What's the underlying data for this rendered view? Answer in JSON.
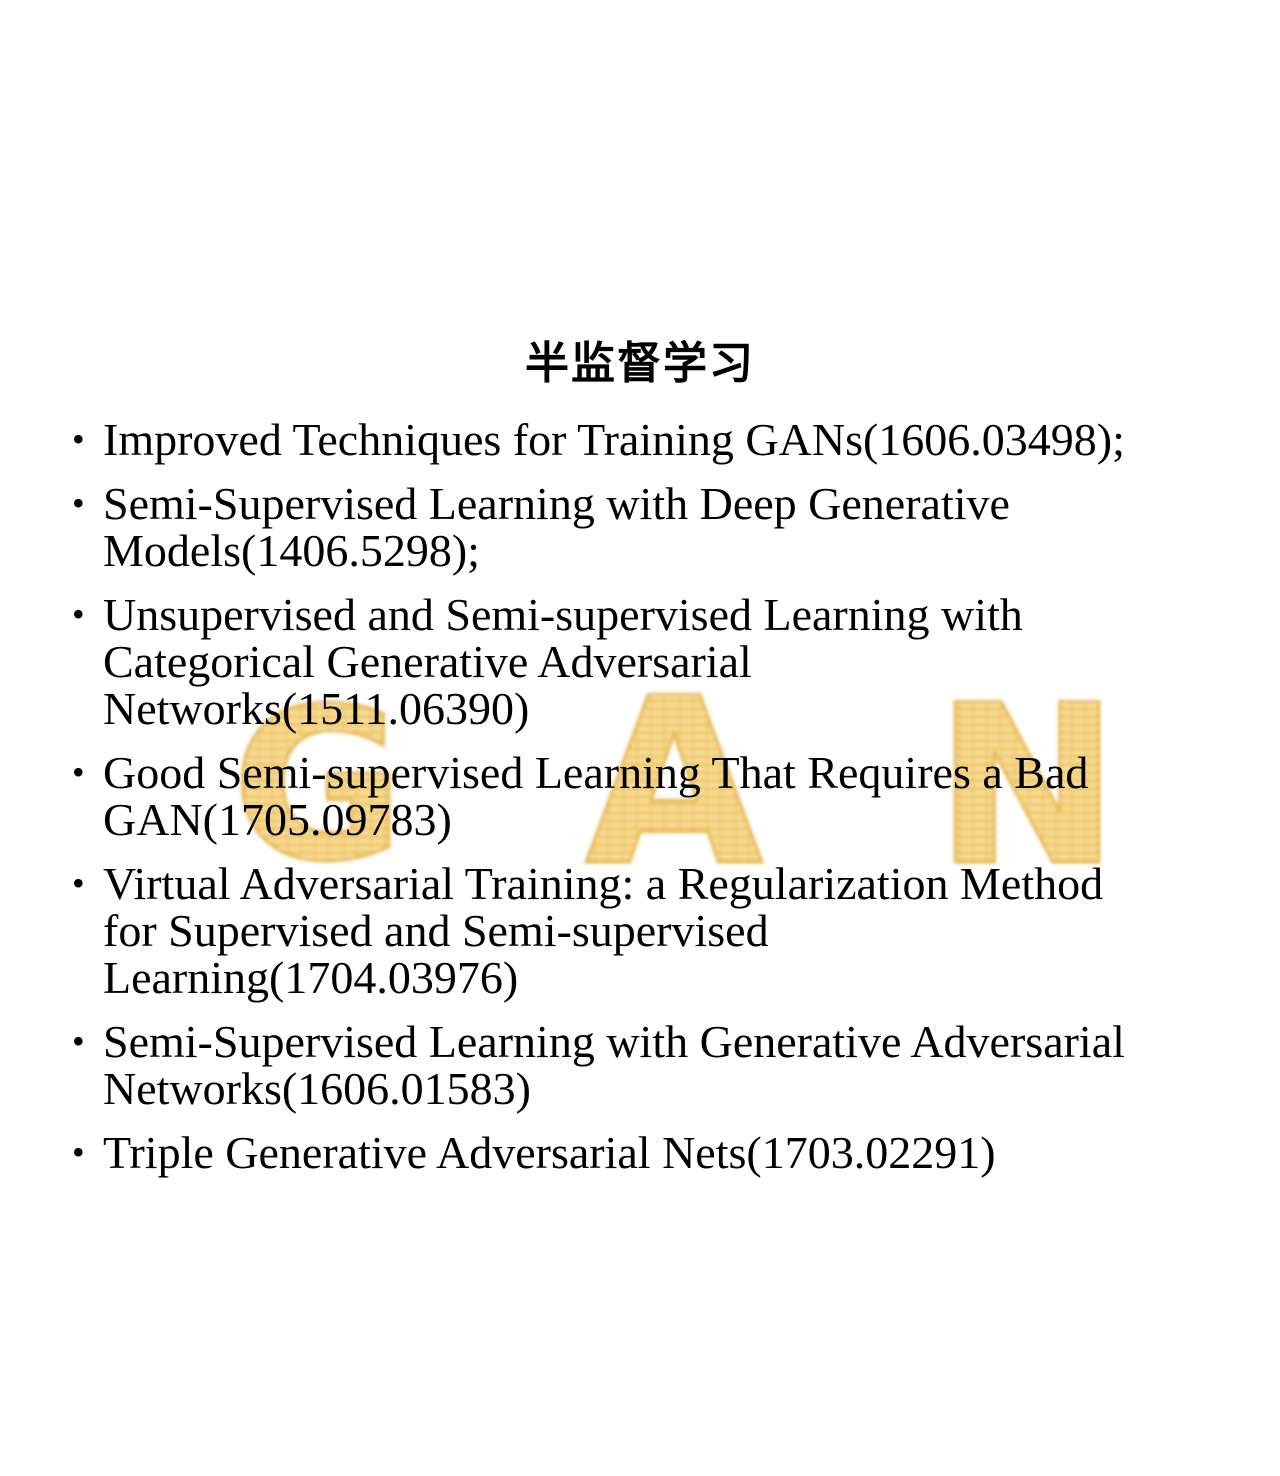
{
  "title": "半监督学习",
  "watermark": {
    "letters": [
      "G",
      "A",
      "N"
    ],
    "color": "#e8b93a"
  },
  "bullet_glyph": "•",
  "references": [
    {
      "lines": [
        "Improved Techniques for Training GANs(1606.03498);"
      ]
    },
    {
      "lines": [
        "Semi-Supervised Learning with Deep Generative",
        "Models(1406.5298);"
      ]
    },
    {
      "lines": [
        "Unsupervised and Semi-supervised Learning with",
        "Categorical Generative Adversarial",
        "Networks(1511.06390)"
      ]
    },
    {
      "lines": [
        "Good Semi-supervised Learning That Requires a Bad",
        "GAN(1705.09783)"
      ]
    },
    {
      "lines": [
        "Virtual Adversarial Training: a Regularization Method",
        "for Supervised and Semi-supervised",
        "Learning(1704.03976)"
      ]
    },
    {
      "lines": [
        "Semi-Supervised Learning with Generative Adversarial",
        "Networks(1606.01583)"
      ]
    },
    {
      "lines": [
        "Triple Generative Adversarial Nets(1703.02291)"
      ]
    }
  ]
}
